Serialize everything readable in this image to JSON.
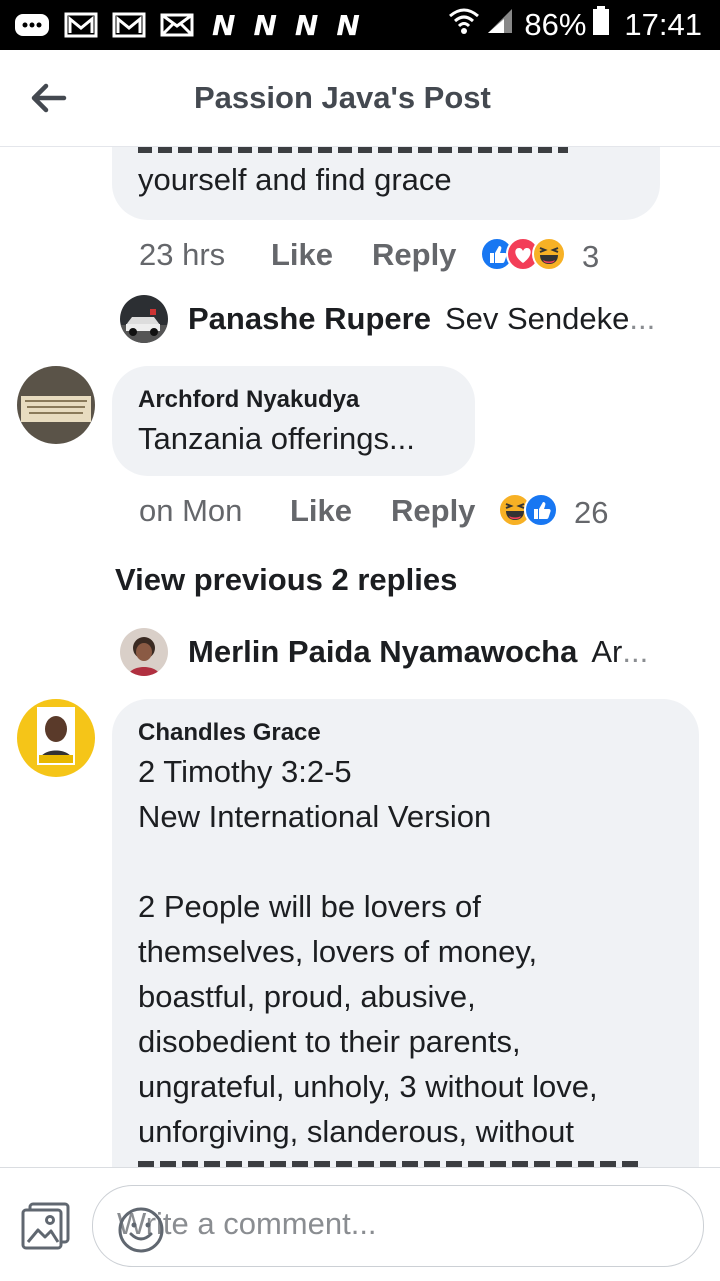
{
  "status_bar": {
    "n_icons": [
      "N",
      "N",
      "N",
      "N"
    ],
    "battery": "86%",
    "time": "17:41"
  },
  "header": {
    "title": "Passion Java's Post"
  },
  "comments": [
    {
      "text_partial": "yourself and find grace",
      "time": "23 hrs",
      "like_label": "Like",
      "reply_label": "Reply",
      "reaction_count": "3",
      "reply_preview": {
        "name": "Panashe Rupere",
        "text": "Sev Sendeke",
        "ellipsis": "..."
      }
    },
    {
      "author": "Archford Nyakudya",
      "text": "Tanzania offerings...",
      "avatar_text": "Nomatter how evil money is ,don't think being broke is holy",
      "time": "on Mon",
      "like_label": "Like",
      "reply_label": "Reply",
      "reaction_count": "26",
      "view_previous": "View previous 2 replies",
      "reply_preview": {
        "name": "Merlin Paida Nyamawocha",
        "text": "Ar",
        "ellipsis": "..."
      }
    },
    {
      "author": "Chandles Grace",
      "lines": [
        "2 Timothy 3:2-5",
        "New International Version",
        "",
        "2 People will be lovers of",
        "themselves, lovers of money,",
        "boastful, proud, abusive,",
        "disobedient to their parents,",
        "ungrateful, unholy, 3 without love,",
        "unforgiving, slanderous, without"
      ]
    }
  ],
  "composer": {
    "placeholder": "Write a comment..."
  },
  "colors": {
    "bubble": "#f0f2f5",
    "like_blue": "#1877f2",
    "love_red": "#f33e58",
    "haha_yellow": "#f7b125"
  }
}
